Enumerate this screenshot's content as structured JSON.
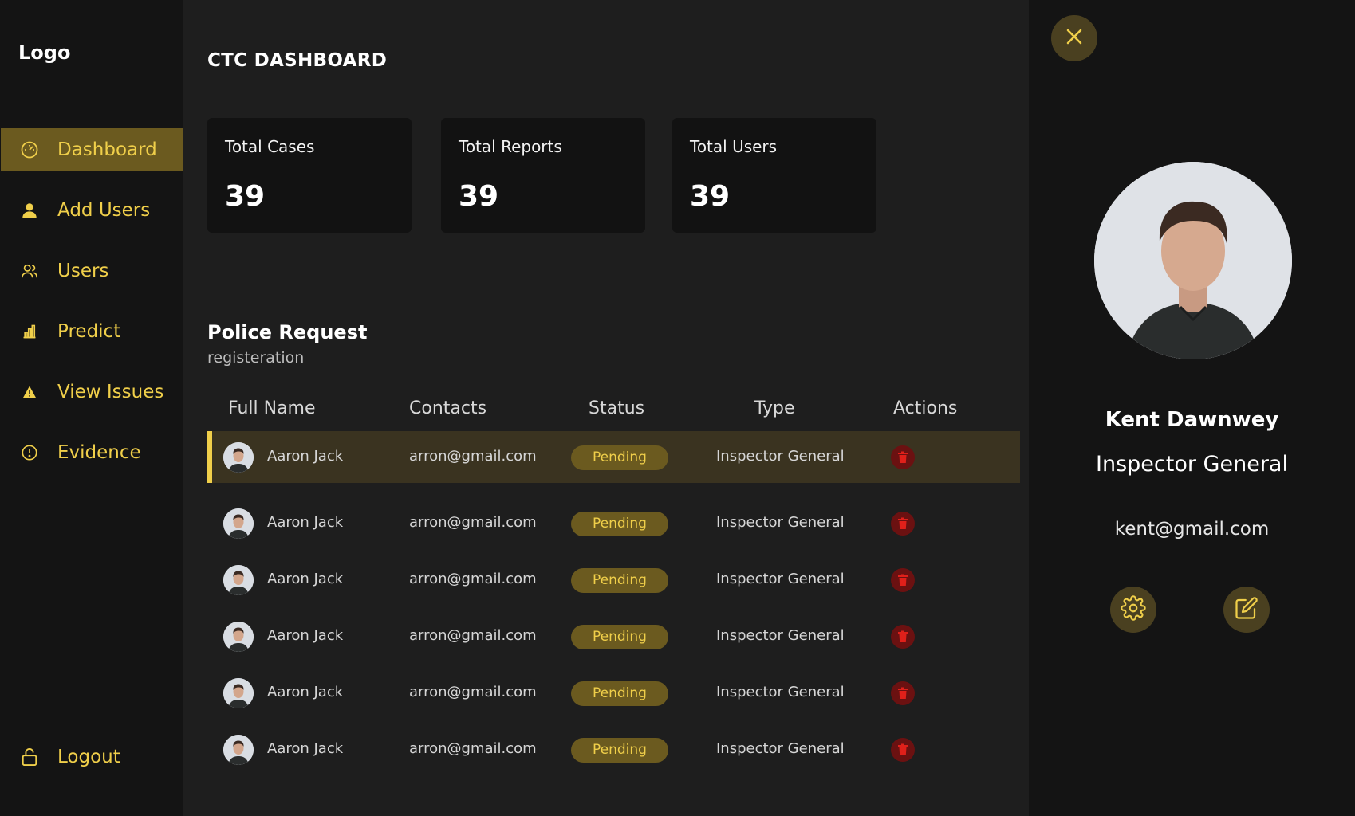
{
  "sidebar": {
    "logo": "Logo",
    "items": [
      {
        "label": "Dashboard",
        "icon": "speedometer-icon"
      },
      {
        "label": "Add Users",
        "icon": "person-icon"
      },
      {
        "label": "Users",
        "icon": "users-icon"
      },
      {
        "label": "Predict",
        "icon": "bar-chart-icon"
      },
      {
        "label": "View Issues",
        "icon": "warning-icon"
      },
      {
        "label": "Evidence",
        "icon": "info-circle-icon"
      }
    ],
    "logout": "Logout",
    "active": "Dashboard"
  },
  "header": {
    "title": "CTC DASHBOARD"
  },
  "stats": [
    {
      "label": "Total Cases",
      "value": "39"
    },
    {
      "label": "Total Reports",
      "value": "39"
    },
    {
      "label": "Total Users",
      "value": "39"
    }
  ],
  "requests": {
    "title": "Police Request",
    "subtitle": "registeration",
    "columns": [
      "Full Name",
      "Contacts",
      "Status",
      "Type",
      "Actions"
    ],
    "rows": [
      {
        "name": "Aaron Jack",
        "contact": "arron@gmail.com",
        "status": "Pending",
        "type": "Inspector General"
      },
      {
        "name": "Aaron Jack",
        "contact": "arron@gmail.com",
        "status": "Pending",
        "type": "Inspector General"
      },
      {
        "name": "Aaron Jack",
        "contact": "arron@gmail.com",
        "status": "Pending",
        "type": "Inspector General"
      },
      {
        "name": "Aaron Jack",
        "contact": "arron@gmail.com",
        "status": "Pending",
        "type": "Inspector General"
      },
      {
        "name": "Aaron Jack",
        "contact": "arron@gmail.com",
        "status": "Pending",
        "type": "Inspector General"
      },
      {
        "name": "Aaron Jack",
        "contact": "arron@gmail.com",
        "status": "Pending",
        "type": "Inspector General"
      }
    ]
  },
  "profile": {
    "name": "Kent Dawnwey",
    "role": "Inspector General",
    "email": "kent@gmail.com"
  },
  "colors": {
    "accent": "#f0cf4a",
    "accent_dark": "#6b5a1f",
    "danger": "#6b1111",
    "danger_icon": "#e0201a"
  }
}
